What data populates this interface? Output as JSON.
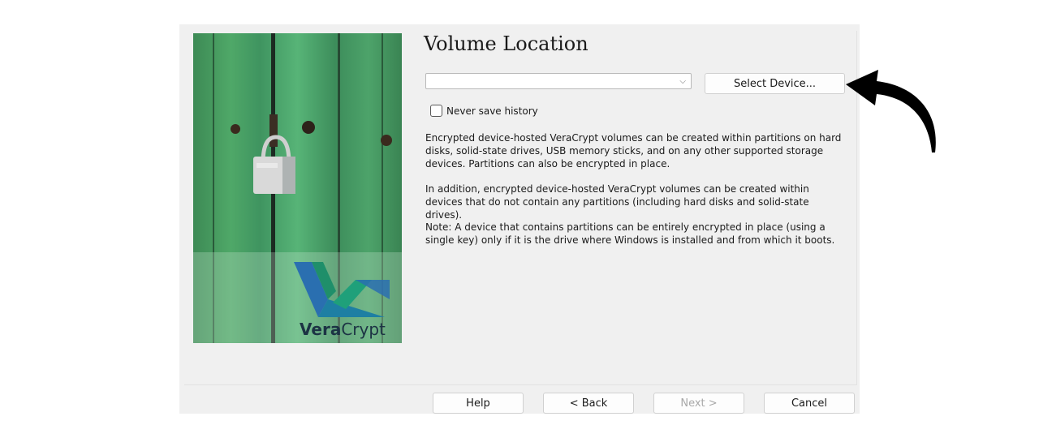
{
  "page": {
    "title": "Volume Location",
    "volume_input": {
      "value": "",
      "placeholder": ""
    },
    "select_device_label": "Select Device...",
    "never_save_history_label": "Never save history",
    "paragraphs": [
      "Encrypted device-hosted VeraCrypt volumes can be created within partitions on hard disks, solid-state drives, USB memory sticks, and on any other supported storage devices. Partitions can also be encrypted in place.",
      "In addition, encrypted device-hosted VeraCrypt volumes can be created within devices that do not contain any partitions (including hard disks and solid-state drives).",
      "Note: A device that contains partitions can be entirely encrypted in place (using a single key) only if it is the drive where Windows is installed and from which it boots."
    ]
  },
  "logo": {
    "bold": "Vera",
    "regular": "Crypt"
  },
  "buttons": {
    "help": "Help",
    "back": "< Back",
    "next": "Next >",
    "cancel": "Cancel"
  },
  "annotation": {
    "icon": "curved-arrow-icon",
    "color": "#000000"
  },
  "colors": {
    "dialog_bg": "#f0f0f0",
    "banner_green": "#4fa868",
    "logo_blue": "#2a6fb0",
    "logo_teal": "#1fa07a"
  }
}
